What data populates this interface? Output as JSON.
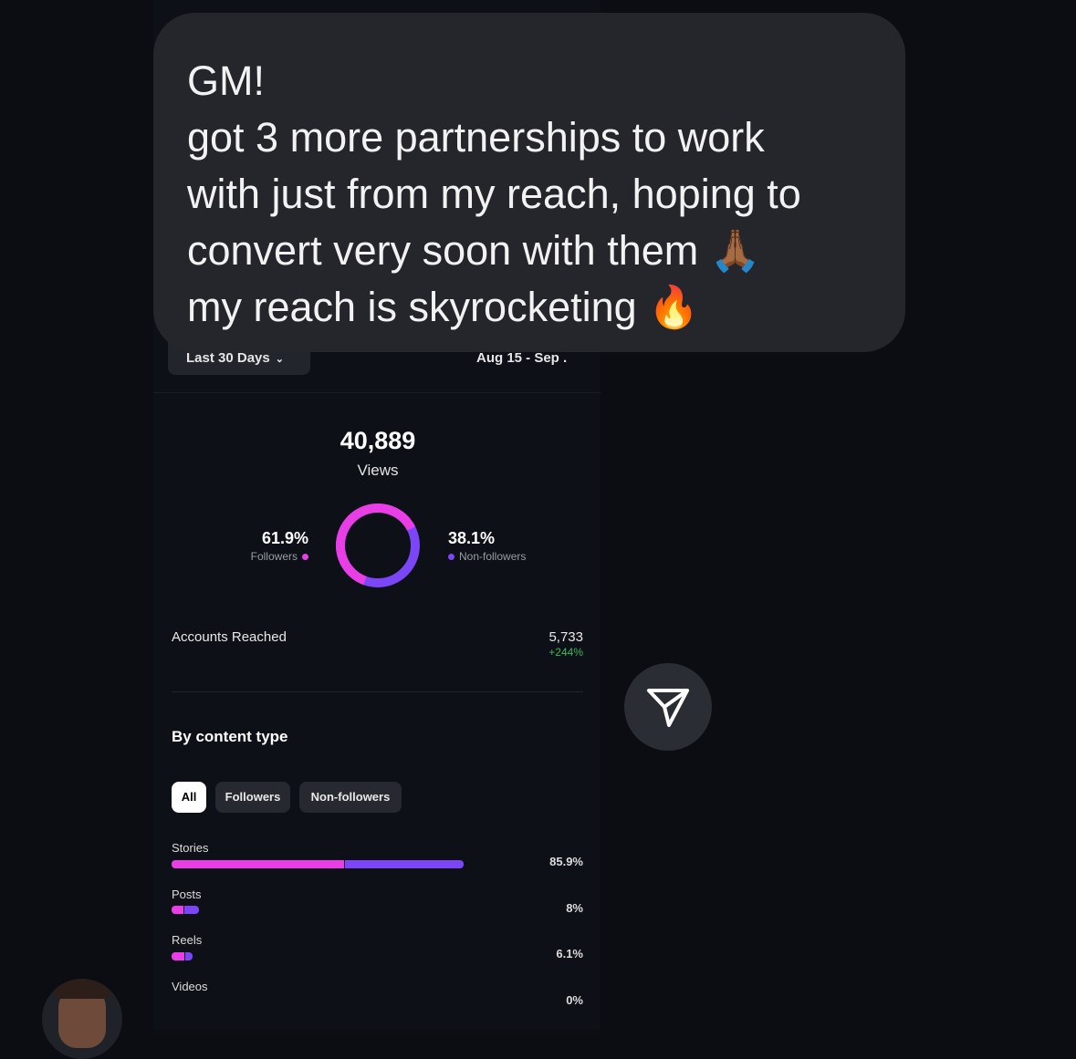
{
  "message": {
    "lines": [
      "GM!",
      "got 3 more partnerships to work",
      "with just from my reach, hoping to",
      "convert very soon with them 🙏🏾",
      "my reach is skyrocketing 🔥"
    ]
  },
  "insights": {
    "filter_label": "Last 30 Days",
    "date_range": "Aug 15 - Sep .",
    "views": {
      "value": "40,889",
      "label": "Views"
    },
    "breakdown": {
      "followers": {
        "percent": "61.9%",
        "label": "Followers",
        "fraction": 0.619
      },
      "non_followers": {
        "percent": "38.1%",
        "label": "Non-followers",
        "fraction": 0.381
      }
    },
    "accounts_reached": {
      "label": "Accounts Reached",
      "value": "5,733",
      "change": "+244%"
    },
    "content_type": {
      "title": "By content type",
      "tabs": [
        "All",
        "Followers",
        "Non-followers"
      ],
      "selected_tab": "All",
      "rows": [
        {
          "label": "Stories",
          "percent": "85.9%",
          "value": 85.9,
          "followers_share": 0.59
        },
        {
          "label": "Posts",
          "percent": "8%",
          "value": 8,
          "followers_share": 0.45
        },
        {
          "label": "Reels",
          "percent": "6.1%",
          "value": 6.1,
          "followers_share": 0.6
        },
        {
          "label": "Videos",
          "percent": "0%",
          "value": 0,
          "followers_share": 0
        }
      ]
    }
  },
  "colors": {
    "followers": "#e93ee6",
    "non_followers": "#7b46f6",
    "positive_change": "#3fb85a",
    "bubble": "#24262c"
  },
  "icons": {
    "send": "send-arrow-icon",
    "avatar": "avatar"
  }
}
